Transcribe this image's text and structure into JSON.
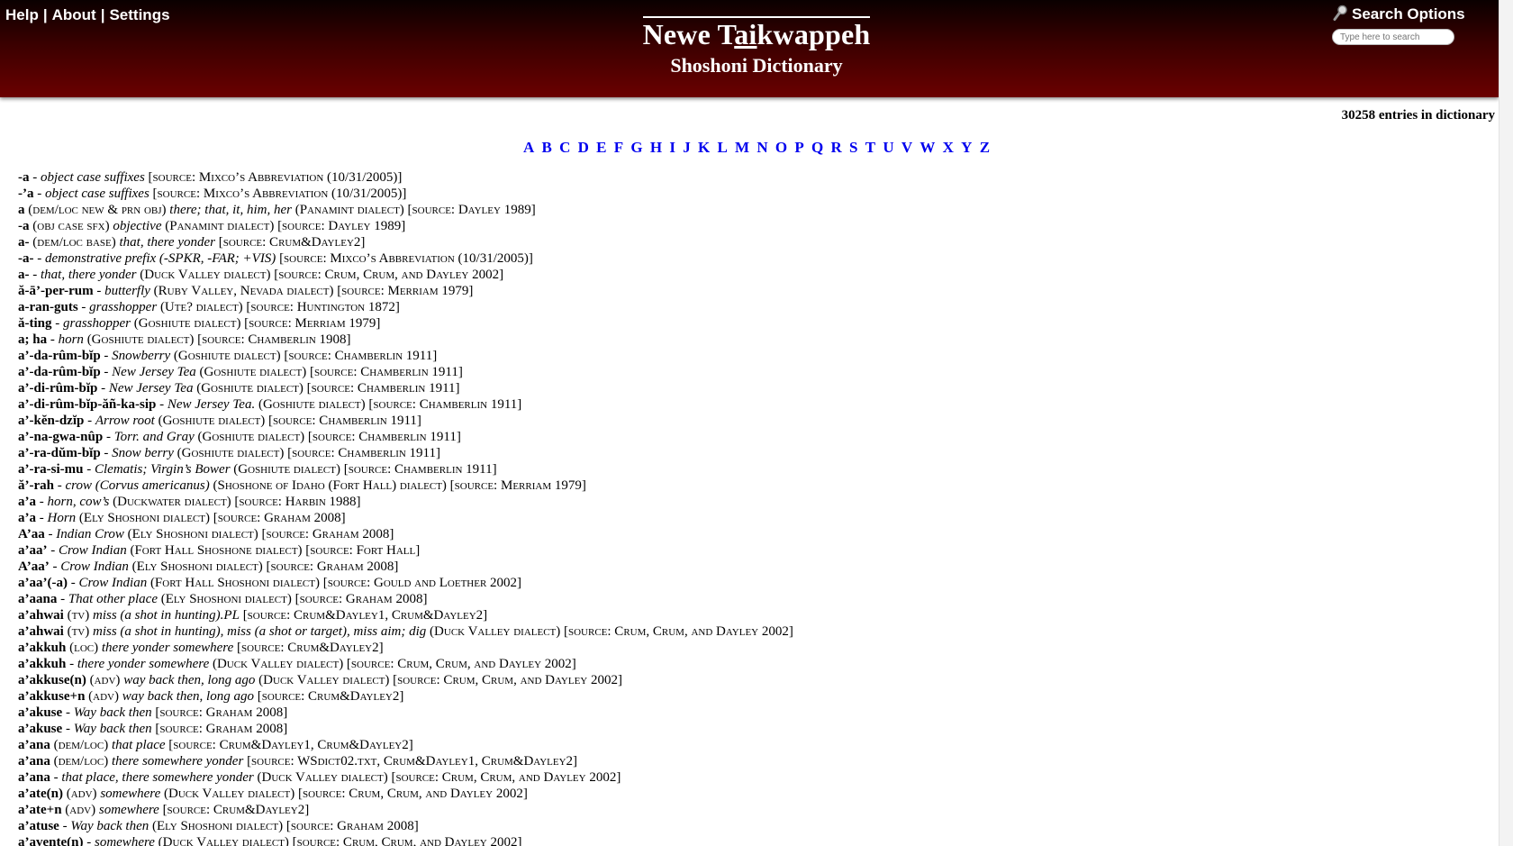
{
  "nav": {
    "help": "Help",
    "about": "About",
    "settings": "Settings",
    "sep": "|"
  },
  "site": {
    "title_a": "Newe T",
    "title_ul": "ai",
    "title_b": "kwappeh",
    "subtitle": "Shoshoni Dictionary"
  },
  "search": {
    "label": "Search Options",
    "placeholder": "Type here to search"
  },
  "entry_count": "30258 entries in dictionary",
  "alphabet": [
    "A",
    "B",
    "C",
    "D",
    "E",
    "F",
    "G",
    "H",
    "I",
    "J",
    "K",
    "L",
    "M",
    "N",
    "O",
    "P",
    "Q",
    "R",
    "S",
    "T",
    "U",
    "V",
    "W",
    "X",
    "Y",
    "Z"
  ],
  "entries": [
    {
      "hw": "-a",
      "pos": "",
      "def": "object case suffixes",
      "rest": "[source: Mixco’s Abbreviation (10/31/2005)]"
    },
    {
      "hw": "-’a",
      "pos": "",
      "def": "object case suffixes",
      "rest": "[source: Mixco’s Abbreviation (10/31/2005)]"
    },
    {
      "hw": "a",
      "pos": "(dem/loc new & prn obj)",
      "def": "there; that, it, him, her",
      "rest": "(Panamint dialect) [source: Dayley 1989]"
    },
    {
      "hw": "-a",
      "pos": "(obj case sfx)",
      "def": "objective",
      "rest": "(Panamint dialect) [source: Dayley 1989]"
    },
    {
      "hw": "a-",
      "pos": "(dem/loc base)",
      "def": "that, there yonder",
      "rest": "[source: Crum&Dayley2]"
    },
    {
      "hw": "-a-",
      "pos": "",
      "def": "demonstrative prefix (-SPKR, -FAR; +VIS)",
      "rest": "[source: Mixco’s Abbreviation (10/31/2005)]"
    },
    {
      "hw": "a-",
      "pos": "",
      "def": "that, there yonder",
      "rest": "(Duck Valley dialect) [source: Crum, Crum, and Dayley 2002]"
    },
    {
      "hw": "ă-ā’-per-rum",
      "pos": "",
      "def": "butterfly",
      "rest": "(Ruby Valley, Nevada dialect) [source: Merriam 1979]"
    },
    {
      "hw": "a-ran-guts",
      "pos": "",
      "def": "grasshopper",
      "rest": "(Ute? dialect) [source: Huntington 1872]"
    },
    {
      "hw": "ă-ting",
      "pos": "",
      "def": "grasshopper",
      "rest": "(Goshiute dialect) [source: Merriam 1979]"
    },
    {
      "hw": "a; ha",
      "pos": "",
      "def": "horn",
      "rest": "(Goshiute dialect) [source: Chamberlin 1908]"
    },
    {
      "hw": "a’-da-rûm-bĭp",
      "pos": "",
      "def": "Snowberry",
      "rest": "(Goshiute dialect) [source: Chamberlin 1911]"
    },
    {
      "hw": "a’-da-rûm-bĭp",
      "pos": "",
      "def": "New Jersey Tea",
      "rest": "(Goshiute dialect) [source: Chamberlin 1911]"
    },
    {
      "hw": "a’-di-rûm-bĭp",
      "pos": "",
      "def": "New Jersey Tea",
      "rest": "(Goshiute dialect) [source: Chamberlin 1911]"
    },
    {
      "hw": "a’-di-rûm-bĭp-ăñ-ka-sip",
      "pos": "",
      "def": "New Jersey Tea.",
      "rest": "(Goshiute dialect) [source: Chamberlin 1911]"
    },
    {
      "hw": "a’-kĕn-dzĭp",
      "pos": "",
      "def": "Arrow root",
      "rest": "(Goshiute dialect) [source: Chamberlin 1911]"
    },
    {
      "hw": "a’-na-gwa-nûp",
      "pos": "",
      "def": "Torr. and Gray",
      "rest": "(Goshiute dialect) [source: Chamberlin 1911]"
    },
    {
      "hw": "a’-ra-dŭm-bĭp",
      "pos": "",
      "def": "Snow berry",
      "rest": "(Goshiute dialect) [source: Chamberlin 1911]"
    },
    {
      "hw": "a’-ra-si-mu",
      "pos": "",
      "def": "Clematis; Virgin’s Bower",
      "rest": "(Goshiute dialect) [source: Chamberlin 1911]"
    },
    {
      "hw": "ă’-rah",
      "pos": "",
      "def": "crow (Corvus americanus)",
      "rest": "(Shoshone of Idaho (Fort Hall) dialect) [source: Merriam 1979]"
    },
    {
      "hw": "a’a",
      "pos": "",
      "def": "horn, cow’s",
      "rest": "(Duckwater dialect) [source: Harbin 1988]"
    },
    {
      "hw": "a’a",
      "pos": "",
      "def": "Horn",
      "rest": "(Ely Shoshoni dialect) [source: Graham 2008]"
    },
    {
      "hw": "A’aa",
      "pos": "",
      "def": "Indian Crow",
      "rest": "(Ely Shoshoni dialect) [source: Graham 2008]"
    },
    {
      "hw": "a’aa’",
      "pos": "",
      "def": "Crow Indian",
      "rest": "(Fort Hall Shoshone dialect) [source: Fort Hall]"
    },
    {
      "hw": "A’aa’",
      "pos": "",
      "def": "Crow Indian",
      "rest": "(Ely Shoshoni dialect) [source: Graham 2008]"
    },
    {
      "hw": "a’aa’(-a)",
      "pos": "",
      "def": "Crow Indian",
      "rest": "(Fort Hall Shoshoni dialect) [source: Gould and Loether 2002]"
    },
    {
      "hw": "a’aana",
      "pos": "",
      "def": "That other place",
      "rest": "(Ely Shoshoni dialect) [source: Graham 2008]"
    },
    {
      "hw": "a’ahwai",
      "pos": "(tv)",
      "def": "miss (a shot in hunting).PL",
      "rest": "[source: Crum&Dayley1, Crum&Dayley2]"
    },
    {
      "hw": "a’ahwai",
      "pos": "(tv)",
      "def": "miss (a shot in hunting), miss (a shot or target), miss aim; dig",
      "rest": "(Duck Valley dialect) [source: Crum, Crum, and Dayley 2002]"
    },
    {
      "hw": "a’akkuh",
      "pos": "(loc)",
      "def": "there yonder somewhere",
      "rest": "[source: Crum&Dayley2]"
    },
    {
      "hw": "a’akkuh",
      "pos": "",
      "def": "there yonder somewhere",
      "rest": "(Duck Valley dialect) [source: Crum, Crum, and Dayley 2002]"
    },
    {
      "hw": "a’akkuse(n)",
      "pos": "(adv)",
      "def": "way back then, long ago",
      "rest": "(Duck Valley dialect) [source: Crum, Crum, and Dayley 2002]"
    },
    {
      "hw": "a’akkuse+n",
      "pos": "(adv)",
      "def": "way back then, long ago",
      "rest": "[source: Crum&Dayley2]"
    },
    {
      "hw": "a’akuse",
      "pos": "",
      "def": "Way back then",
      "rest": "[source: Graham 2008]"
    },
    {
      "hw": "a’akuse",
      "pos": "",
      "def": "Way back then",
      "rest": "[source: Graham 2008]"
    },
    {
      "hw": "a’ana",
      "pos": "(dem/loc)",
      "def": "that place",
      "rest": "[source: Crum&Dayley1, Crum&Dayley2]"
    },
    {
      "hw": "a’ana",
      "pos": "(dem/loc)",
      "def": "there somewhere yonder",
      "rest": "[source: WSdict02.txt, Crum&Dayley1, Crum&Dayley2]"
    },
    {
      "hw": "a’ana",
      "pos": "",
      "def": "that place, there somewhere yonder",
      "rest": "(Duck Valley dialect) [source: Crum, Crum, and Dayley 2002]"
    },
    {
      "hw": "a’ate(n)",
      "pos": "(adv)",
      "def": "somewhere",
      "rest": "(Duck Valley dialect) [source: Crum, Crum, and Dayley 2002]"
    },
    {
      "hw": "a’ate+n",
      "pos": "(adv)",
      "def": "somewhere",
      "rest": "[source: Crum&Dayley2]"
    },
    {
      "hw": "a’atuse",
      "pos": "",
      "def": "Way back then",
      "rest": "(Ely Shoshoni dialect) [source: Graham 2008]"
    },
    {
      "hw": "a’avente(n)",
      "pos": "",
      "def": "somewhere",
      "rest": "(Duck Valley dialect) [source: Crum, Crum, and Dayley 2002]"
    }
  ]
}
